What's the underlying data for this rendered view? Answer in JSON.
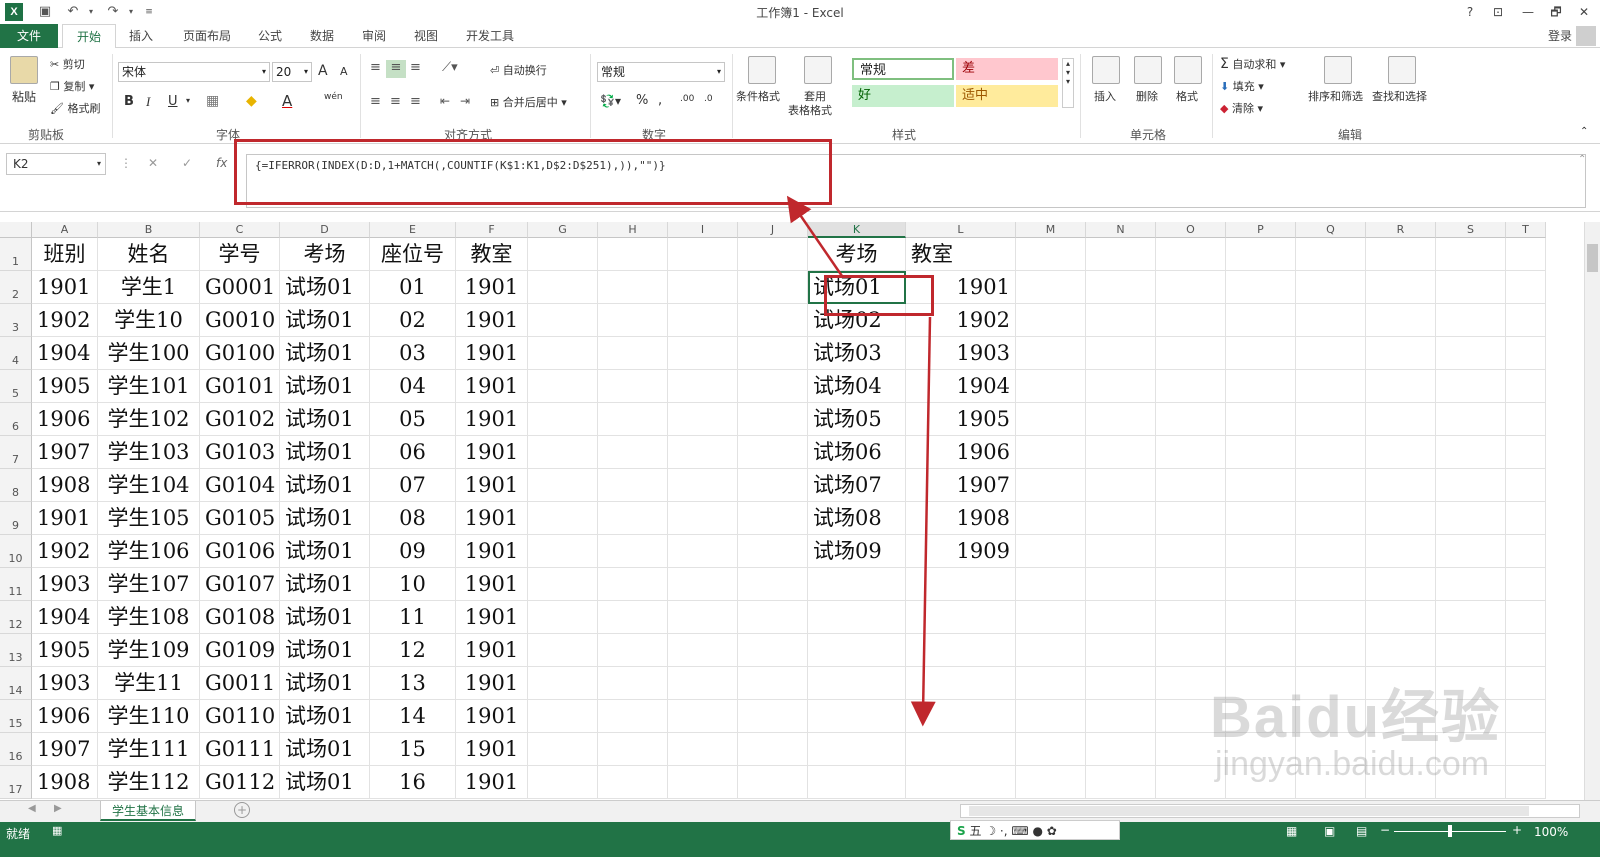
{
  "window": {
    "title": "工作簿1 - Excel",
    "help": "?",
    "restore_ribbon": "⊡",
    "minimize": "—",
    "maximize": "🗗",
    "close": "✕"
  },
  "qat": {
    "save_icon": "save-icon",
    "undo_icon": "undo-icon",
    "redo_icon": "redo-icon"
  },
  "tabs": [
    "文件",
    "开始",
    "插入",
    "页面布局",
    "公式",
    "数据",
    "审阅",
    "视图",
    "开发工具"
  ],
  "login": "登录",
  "ribbon": {
    "clipboard": {
      "paste": "粘贴",
      "cut": "剪切",
      "copy": "复制",
      "format_painter": "格式刷",
      "label": "剪贴板"
    },
    "font": {
      "name": "宋体",
      "size": "20",
      "bold": "B",
      "italic": "I",
      "underline": "U",
      "label": "字体",
      "grow": "A",
      "shrink": "A",
      "wen": "wén"
    },
    "alignment": {
      "wrap": "自动换行",
      "merge": "合并后居中",
      "label": "对齐方式"
    },
    "number": {
      "format": "常规",
      "percent": "%",
      "comma": ",",
      "label": "数字"
    },
    "styles": {
      "conditional": "条件格式",
      "table_format": "套用\n表格格式",
      "table_format_line1": "套用",
      "table_format_line2": "表格格式",
      "normal": "常规",
      "bad": "差",
      "good": "好",
      "neutral": "适中",
      "label": "样式"
    },
    "cells": {
      "insert": "插入",
      "delete": "删除",
      "format": "格式",
      "label": "单元格"
    },
    "editing": {
      "autosum": "自动求和",
      "fill": "填充",
      "clear": "清除",
      "sort": "排序和筛选",
      "find": "查找和选择",
      "label": "编辑"
    }
  },
  "formula_bar": {
    "name_box": "K2",
    "formula": "{=IFERROR(INDEX(D:D,1+MATCH(,COUNTIF(K$1:K1,D$2:D$251),)),\"\")}",
    "fx": "fx"
  },
  "columns": [
    "A",
    "B",
    "C",
    "D",
    "E",
    "F",
    "G",
    "H",
    "I",
    "J",
    "K",
    "L",
    "M",
    "N",
    "O",
    "P",
    "Q",
    "R",
    "S",
    "T"
  ],
  "rows": [
    "1",
    "2",
    "3",
    "4",
    "5",
    "6",
    "7",
    "8",
    "9",
    "10",
    "11",
    "12",
    "13",
    "14",
    "15",
    "16",
    "17"
  ],
  "table_left": {
    "headers": [
      "班别",
      "姓名",
      "学号",
      "考场",
      "座位号",
      "教室"
    ],
    "data": [
      [
        "1901",
        "学生1",
        "G0001",
        "试场01",
        "01",
        "1901"
      ],
      [
        "1902",
        "学生10",
        "G0010",
        "试场01",
        "02",
        "1901"
      ],
      [
        "1904",
        "学生100",
        "G0100",
        "试场01",
        "03",
        "1901"
      ],
      [
        "1905",
        "学生101",
        "G0101",
        "试场01",
        "04",
        "1901"
      ],
      [
        "1906",
        "学生102",
        "G0102",
        "试场01",
        "05",
        "1901"
      ],
      [
        "1907",
        "学生103",
        "G0103",
        "试场01",
        "06",
        "1901"
      ],
      [
        "1908",
        "学生104",
        "G0104",
        "试场01",
        "07",
        "1901"
      ],
      [
        "1901",
        "学生105",
        "G0105",
        "试场01",
        "08",
        "1901"
      ],
      [
        "1902",
        "学生106",
        "G0106",
        "试场01",
        "09",
        "1901"
      ],
      [
        "1903",
        "学生107",
        "G0107",
        "试场01",
        "10",
        "1901"
      ],
      [
        "1904",
        "学生108",
        "G0108",
        "试场01",
        "11",
        "1901"
      ],
      [
        "1905",
        "学生109",
        "G0109",
        "试场01",
        "12",
        "1901"
      ],
      [
        "1903",
        "学生11",
        "G0011",
        "试场01",
        "13",
        "1901"
      ],
      [
        "1906",
        "学生110",
        "G0110",
        "试场01",
        "14",
        "1901"
      ],
      [
        "1907",
        "学生111",
        "G0111",
        "试场01",
        "15",
        "1901"
      ],
      [
        "1908",
        "学生112",
        "G0112",
        "试场01",
        "16",
        "1901"
      ]
    ]
  },
  "table_right": {
    "headers": [
      "考场",
      "教室"
    ],
    "data": [
      [
        "试场01",
        "1901"
      ],
      [
        "试场02",
        "1902"
      ],
      [
        "试场03",
        "1903"
      ],
      [
        "试场04",
        "1904"
      ],
      [
        "试场05",
        "1905"
      ],
      [
        "试场06",
        "1906"
      ],
      [
        "试场07",
        "1907"
      ],
      [
        "试场08",
        "1908"
      ],
      [
        "试场09",
        "1909"
      ]
    ]
  },
  "sheet_tabs": [
    "学生基本信息"
  ],
  "status": {
    "ready": "就绪",
    "zoom": "100%",
    "ime": "五"
  },
  "watermark": {
    "line1": "Baidu经验",
    "line2": "jingyan.baidu.com"
  },
  "colors": {
    "excel_green": "#217346",
    "annotation_red": "#c0282d",
    "good_bg": "#c6efce",
    "bad_bg": "#ffc7ce",
    "neutral_bg": "#ffeb9c"
  }
}
